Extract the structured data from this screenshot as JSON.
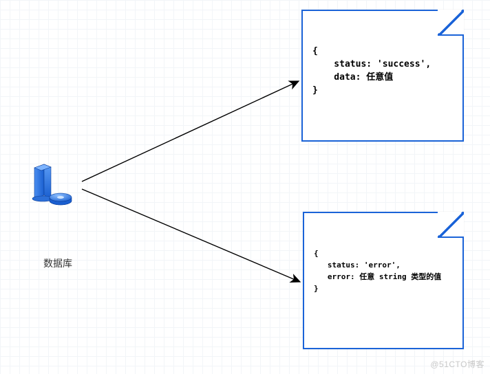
{
  "database": {
    "label": "数据库"
  },
  "docs": {
    "success": {
      "lines": [
        "{",
        "    status: 'success',",
        "    data: 任意值",
        "}"
      ]
    },
    "error": {
      "lines": [
        "{",
        "   status: 'error',",
        "   error: 任意 string 类型的值",
        "}"
      ]
    }
  },
  "watermark": "@51CTO博客"
}
